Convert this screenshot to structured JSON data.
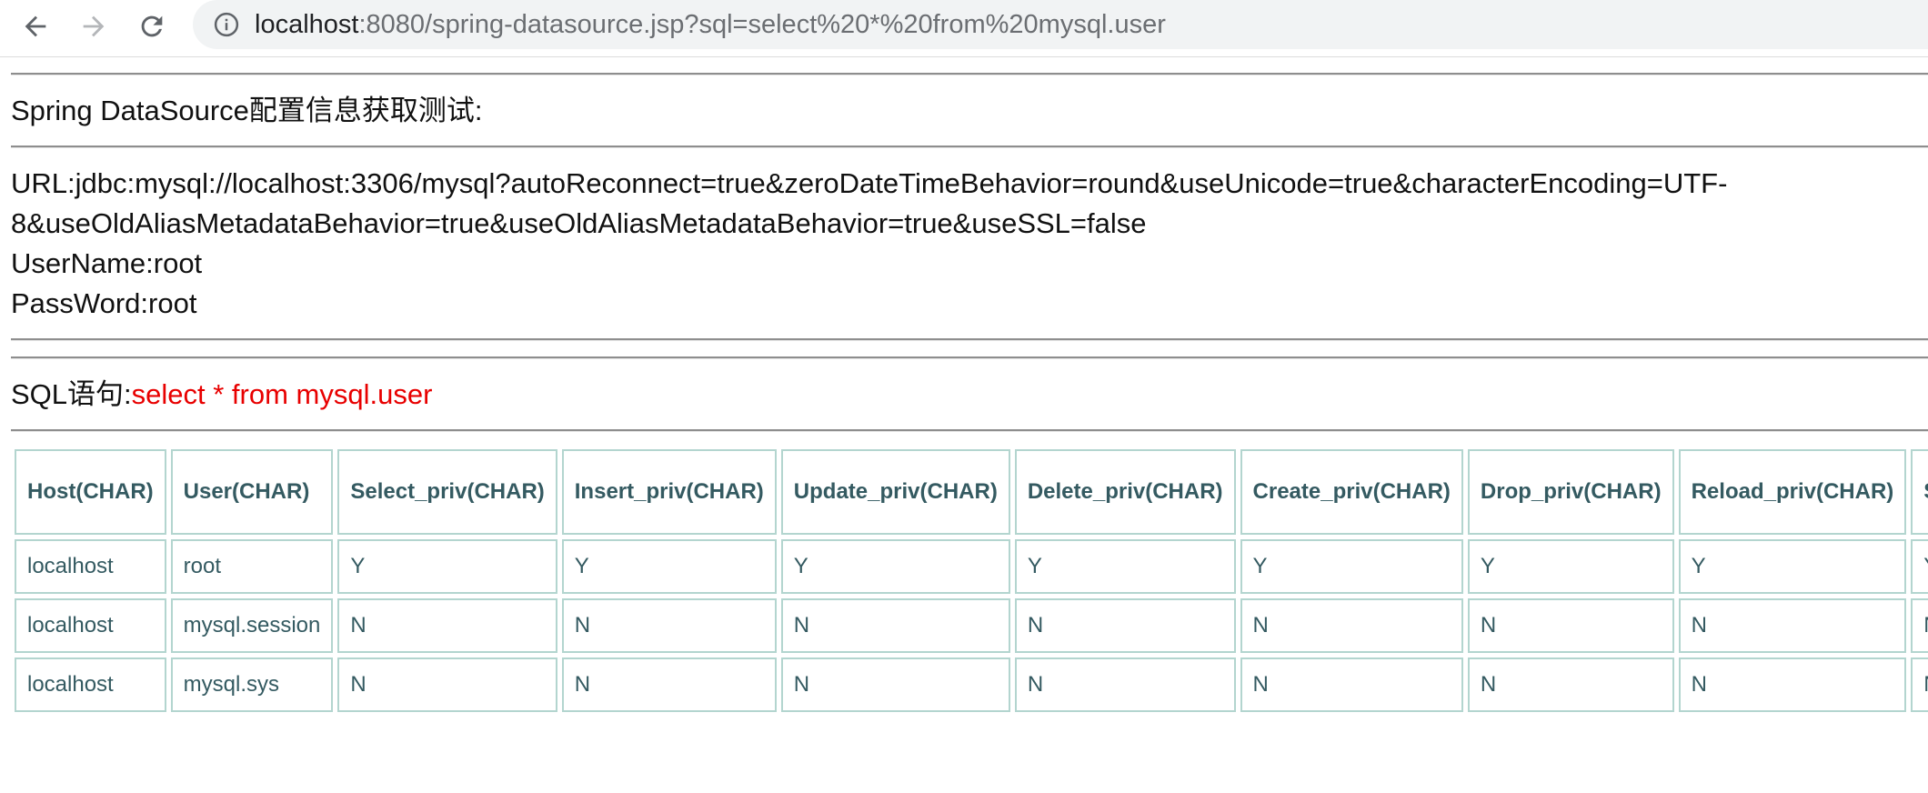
{
  "browser": {
    "url_host": "localhost",
    "url_rest": ":8080/spring-datasource.jsp?sql=select%20*%20from%20mysql.user"
  },
  "page": {
    "heading": "Spring DataSource配置信息获取测试:",
    "url_line1": "URL:jdbc:mysql://localhost:3306/mysql?autoReconnect=true&zeroDateTimeBehavior=round&useUnicode=true&characterEncoding=UTF-",
    "url_line2": "8&useOldAliasMetadataBehavior=true&useOldAliasMetadataBehavior=true&useSSL=false",
    "username": "UserName:root",
    "password": "PassWord:root",
    "sql_label": "SQL语句:",
    "sql_query": "select * from mysql.user"
  },
  "table": {
    "headers": [
      "Host(CHAR)",
      "User(CHAR)",
      "Select_priv(CHAR)",
      "Insert_priv(CHAR)",
      "Update_priv(CHAR)",
      "Delete_priv(CHAR)",
      "Create_priv(CHAR)",
      "Drop_priv(CHAR)",
      "Reload_priv(CHAR)",
      "Shu"
    ],
    "rows": [
      [
        "localhost",
        "root",
        "Y",
        "Y",
        "Y",
        "Y",
        "Y",
        "Y",
        "Y",
        "Y"
      ],
      [
        "localhost",
        "mysql.session",
        "N",
        "N",
        "N",
        "N",
        "N",
        "N",
        "N",
        "N"
      ],
      [
        "localhost",
        "mysql.sys",
        "N",
        "N",
        "N",
        "N",
        "N",
        "N",
        "N",
        "N"
      ]
    ]
  }
}
